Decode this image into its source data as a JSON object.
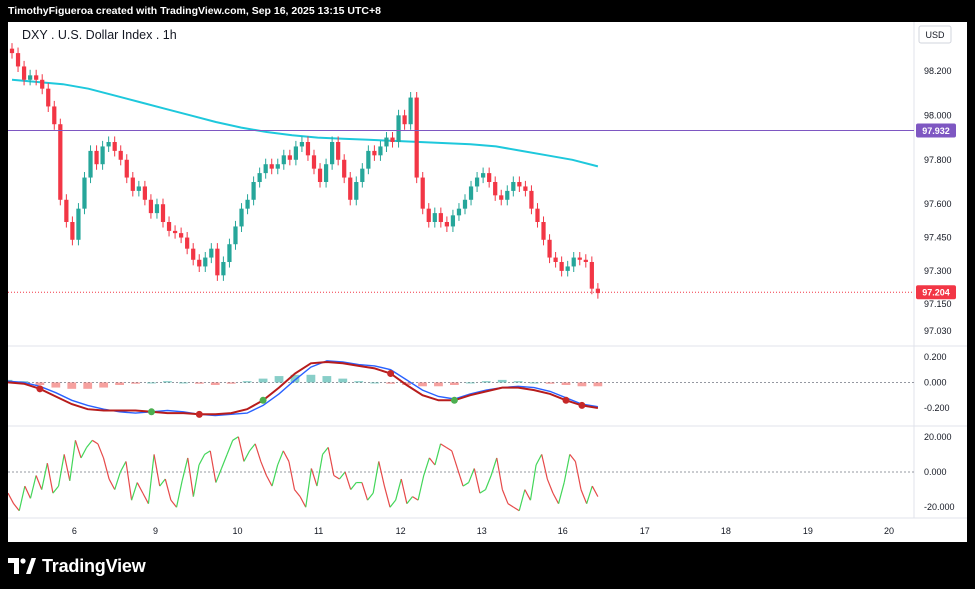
{
  "header": {
    "caption": "TimothyFigueroa created with TradingView.com, Sep 16, 2025 13:15 UTC+8"
  },
  "footer": {
    "brand": "TradingView",
    "logo_icon": "tradingview-logo-icon"
  },
  "colors": {
    "up": "#26a69a",
    "down": "#f23645",
    "ma": "#1ec8dc",
    "hline": "#7e57c2",
    "last": "#f23645",
    "macd": "#2962ff",
    "signal": "#b71c1c",
    "dot_up": "#4caf50",
    "dot_down": "#c62828",
    "osc_up": "#43d65a",
    "osc_down": "#e64a4a"
  },
  "chart_data": [
    {
      "type": "candlestick",
      "title": "DXY . U.S. Dollar Index . 1h",
      "currency": "USD",
      "ylim": [
        96.98,
        98.33
      ],
      "ytick_labels": [
        "98.200",
        "98.000",
        "97.800",
        "97.600",
        "97.450",
        "97.300",
        "97.150",
        "97.030"
      ],
      "yticks": [
        98.2,
        98.0,
        97.8,
        97.6,
        97.45,
        97.3,
        97.15,
        97.03
      ],
      "x_tick_labels": [
        "6",
        "9",
        "10",
        "11",
        "12",
        "13",
        "16",
        "17",
        "18",
        "19",
        "20"
      ],
      "x_ticks": [
        7.7,
        17.1,
        26.6,
        36.0,
        45.5,
        54.9,
        64.3,
        73.8,
        83.2,
        92.7,
        102.1
      ],
      "xlim": [
        0,
        105
      ],
      "horizontal_line": {
        "value": 97.932,
        "label": "97.932"
      },
      "last_price": {
        "value": 97.204,
        "label": "97.204"
      },
      "close_series": [
        98.28,
        98.22,
        98.16,
        98.18,
        98.16,
        98.12,
        98.04,
        97.96,
        97.62,
        97.52,
        97.44,
        97.58,
        97.72,
        97.84,
        97.78,
        97.86,
        97.88,
        97.84,
        97.8,
        97.72,
        97.66,
        97.68,
        97.62,
        97.56,
        97.6,
        97.52,
        97.48,
        97.47,
        97.45,
        97.4,
        97.35,
        97.32,
        97.36,
        97.4,
        97.28,
        97.34,
        97.42,
        97.5,
        97.58,
        97.62,
        97.7,
        97.74,
        97.78,
        97.76,
        97.78,
        97.82,
        97.8,
        97.86,
        97.88,
        97.82,
        97.76,
        97.7,
        97.78,
        97.88,
        97.8,
        97.72,
        97.62,
        97.7,
        97.76,
        97.84,
        97.82,
        97.86,
        97.9,
        97.88,
        98.0,
        97.96,
        98.08,
        97.72,
        97.58,
        97.52,
        97.56,
        97.52,
        97.5,
        97.55,
        97.58,
        97.62,
        97.68,
        97.72,
        97.74,
        97.7,
        97.64,
        97.62,
        97.66,
        97.7,
        97.68,
        97.66,
        97.58,
        97.52,
        97.44,
        97.36,
        97.34,
        97.3,
        97.32,
        97.36,
        97.35,
        97.34,
        97.22,
        97.2
      ],
      "moving_average": [
        98.16,
        98.15,
        98.14,
        98.12,
        98.09,
        98.06,
        98.03,
        98.0,
        97.97,
        97.945,
        97.925,
        97.91,
        97.9,
        97.895,
        97.89,
        97.885,
        97.88,
        97.875,
        97.87,
        97.86,
        97.84,
        97.82,
        97.8,
        97.77
      ]
    },
    {
      "type": "line",
      "name": "MACD",
      "ytick_labels": [
        "0.200",
        "0.000",
        "-0.200"
      ],
      "yticks": [
        0.2,
        0.0,
        -0.2
      ],
      "ylim": [
        -0.31,
        0.27
      ],
      "series": [
        {
          "values": [
            0.01,
            0.0,
            -0.03,
            -0.08,
            -0.14,
            -0.18,
            -0.21,
            -0.23,
            -0.24,
            -0.23,
            -0.22,
            -0.23,
            -0.25,
            -0.26,
            -0.25,
            -0.24,
            -0.18,
            -0.09,
            0.02,
            0.12,
            0.17,
            0.16,
            0.14,
            0.13,
            0.1,
            0.02,
            -0.06,
            -0.11,
            -0.13,
            -0.09,
            -0.06,
            -0.04,
            -0.03,
            -0.04,
            -0.07,
            -0.12,
            -0.17,
            -0.19
          ]
        },
        {
          "values": [
            0.0,
            -0.01,
            -0.05,
            -0.11,
            -0.17,
            -0.21,
            -0.22,
            -0.22,
            -0.22,
            -0.23,
            -0.24,
            -0.24,
            -0.25,
            -0.25,
            -0.24,
            -0.21,
            -0.14,
            -0.04,
            0.07,
            0.15,
            0.16,
            0.15,
            0.13,
            0.11,
            0.07,
            -0.02,
            -0.1,
            -0.14,
            -0.14,
            -0.1,
            -0.07,
            -0.04,
            -0.04,
            -0.06,
            -0.09,
            -0.14,
            -0.18,
            -0.2
          ]
        }
      ],
      "cross_dots": [
        {
          "index": 2,
          "color": "down"
        },
        {
          "index": 9,
          "color": "up"
        },
        {
          "index": 12,
          "color": "down"
        },
        {
          "index": 16,
          "color": "up"
        },
        {
          "index": 24,
          "color": "down"
        },
        {
          "index": 28,
          "color": "up"
        },
        {
          "index": 35,
          "color": "down"
        },
        {
          "index": 36,
          "color": "down"
        }
      ],
      "histogram": [
        0.02,
        0.01,
        -0.02,
        -0.04,
        -0.05,
        -0.05,
        -0.04,
        -0.02,
        -0.01,
        0.0,
        0.01,
        0.0,
        -0.01,
        -0.02,
        -0.01,
        0.01,
        0.03,
        0.05,
        0.06,
        0.06,
        0.05,
        0.03,
        0.01,
        0.0,
        -0.01,
        -0.02,
        -0.03,
        -0.03,
        -0.02,
        0.0,
        0.01,
        0.02,
        0.01,
        0.0,
        -0.01,
        -0.02,
        -0.03,
        -0.03
      ]
    },
    {
      "type": "line",
      "name": "Oscillator",
      "ytick_labels": [
        "20.000",
        "0.000",
        "-20.000"
      ],
      "yticks": [
        20,
        0,
        -20
      ],
      "ylim": [
        -25,
        25
      ],
      "series": [
        {
          "values": [
            -12,
            -18,
            -22,
            -8,
            -15,
            -2,
            -10,
            5,
            -12,
            -8,
            10,
            -5,
            18,
            8,
            14,
            18,
            16,
            8,
            -4,
            -10,
            0,
            6,
            -16,
            -6,
            -12,
            -18,
            10,
            -8,
            -4,
            -16,
            -20,
            -5,
            8,
            -14,
            4,
            10,
            12,
            -6,
            2,
            10,
            18,
            20,
            6,
            12,
            16,
            6,
            -2,
            -8,
            4,
            12,
            6,
            -10,
            -14,
            -20,
            2,
            -8,
            10,
            14,
            -2,
            -4,
            0,
            -10,
            -6,
            -6,
            -16,
            -12,
            6,
            -8,
            -20,
            -16,
            -4,
            -18,
            -14,
            -16,
            -2,
            8,
            4,
            16,
            14,
            12,
            2,
            -8,
            -6,
            2,
            -12,
            -10,
            -2,
            8,
            -10,
            -18,
            -20,
            -22,
            -10,
            -16,
            4,
            10,
            -4,
            -12,
            -18,
            -6,
            10,
            6,
            -10,
            -18,
            -8,
            -14
          ]
        }
      ]
    }
  ]
}
